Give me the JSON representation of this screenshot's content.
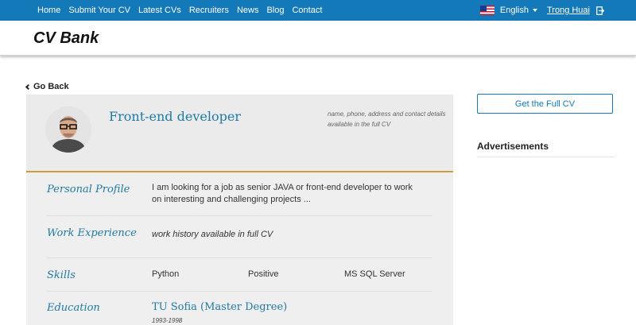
{
  "nav": {
    "links": [
      "Home",
      "Submit Your CV",
      "Latest CVs",
      "Recruiters",
      "News",
      "Blog",
      "Contact"
    ],
    "language": "English",
    "user": "Trong Huai"
  },
  "brand": "CV Bank",
  "back_label": "Go Back",
  "cv": {
    "title": "Front-end developer",
    "contact_note": "name, phone, address and contact details available in the full CV",
    "personal_profile": {
      "label": "Personal Profile",
      "text": "I am looking for a job as senior JAVA or front-end developer to work on interesting and challenging projects ..."
    },
    "work_experience": {
      "label": "Work Experience",
      "note": "work history available in full CV"
    },
    "skills": {
      "label": "Skills",
      "items": [
        "Python",
        "Positive",
        "MS SQL Server"
      ]
    },
    "education": {
      "label": "Education",
      "school": "TU Sofia (Master Degree)",
      "years": "1993-1998"
    }
  },
  "sidebar": {
    "full_cv_button": "Get the Full CV",
    "ads_title": "Advertisements"
  },
  "colors": {
    "nav_bg": "#1479b8",
    "accent": "#1f7aa8",
    "divider": "#d49b3a"
  }
}
